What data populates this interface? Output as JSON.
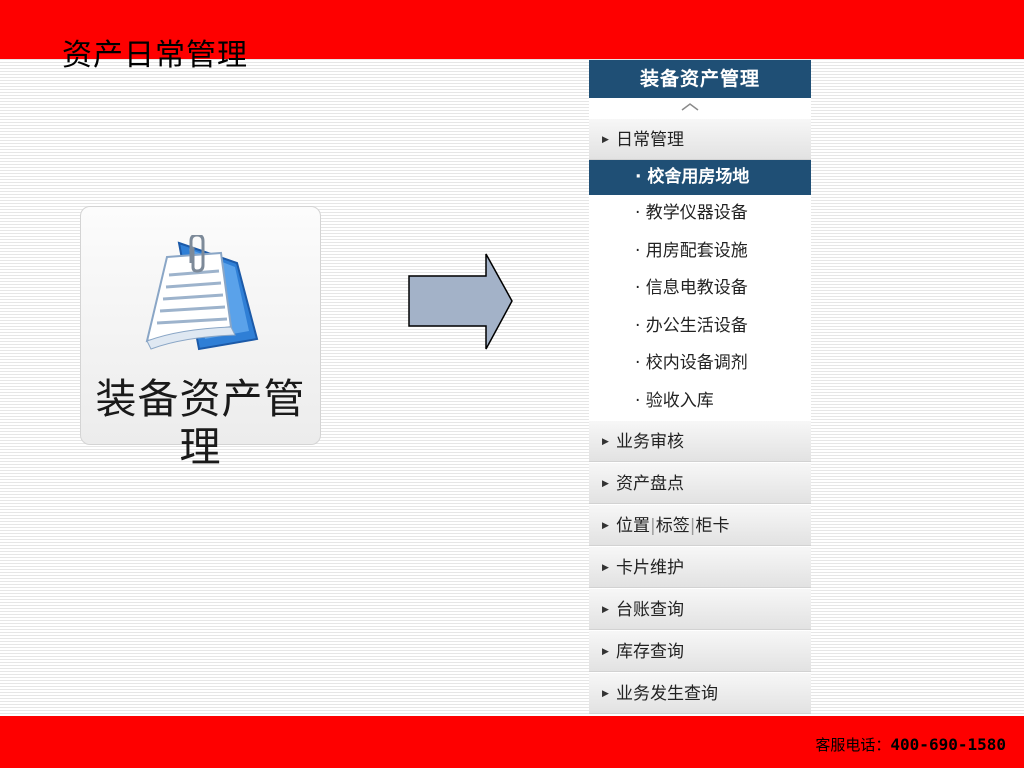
{
  "slide": {
    "title": "资产日常管理",
    "hotline_label": "客服电话：",
    "hotline_number": "400-690-1580"
  },
  "tile": {
    "label": "装备资产管理",
    "icon": "document-with-paperclip-icon"
  },
  "arrow": {
    "icon": "right-arrow-icon",
    "fill": "#a3b2c8"
  },
  "menu": {
    "header": "装备资产管理",
    "collapse_icon": "chevron-up-icon",
    "expanded_group": "日常管理",
    "sub_items": [
      {
        "label": "· 校舍用房场地",
        "active": true
      },
      {
        "label": "· 教学仪器设备",
        "active": false
      },
      {
        "label": "· 用房配套设施",
        "active": false
      },
      {
        "label": "· 信息电教设备",
        "active": false
      },
      {
        "label": "· 办公生活设备",
        "active": false
      },
      {
        "label": "· 校内设备调剂",
        "active": false
      },
      {
        "label": "· 验收入库",
        "active": false
      }
    ],
    "groups": {
      "business_review": "业务审核",
      "asset_inventory": "资产盘点",
      "position": "位置",
      "label_tag": "标签",
      "cabinet_card": "柜卡",
      "card_maintenance": "卡片维护",
      "ledger_query": "台账查询",
      "stock_query": "库存查询",
      "business_query": "业务发生查询"
    }
  },
  "colors": {
    "band_red": "#fe0000",
    "menu_navy": "#1f4f75",
    "arrow_fill": "#a3b2c8"
  }
}
